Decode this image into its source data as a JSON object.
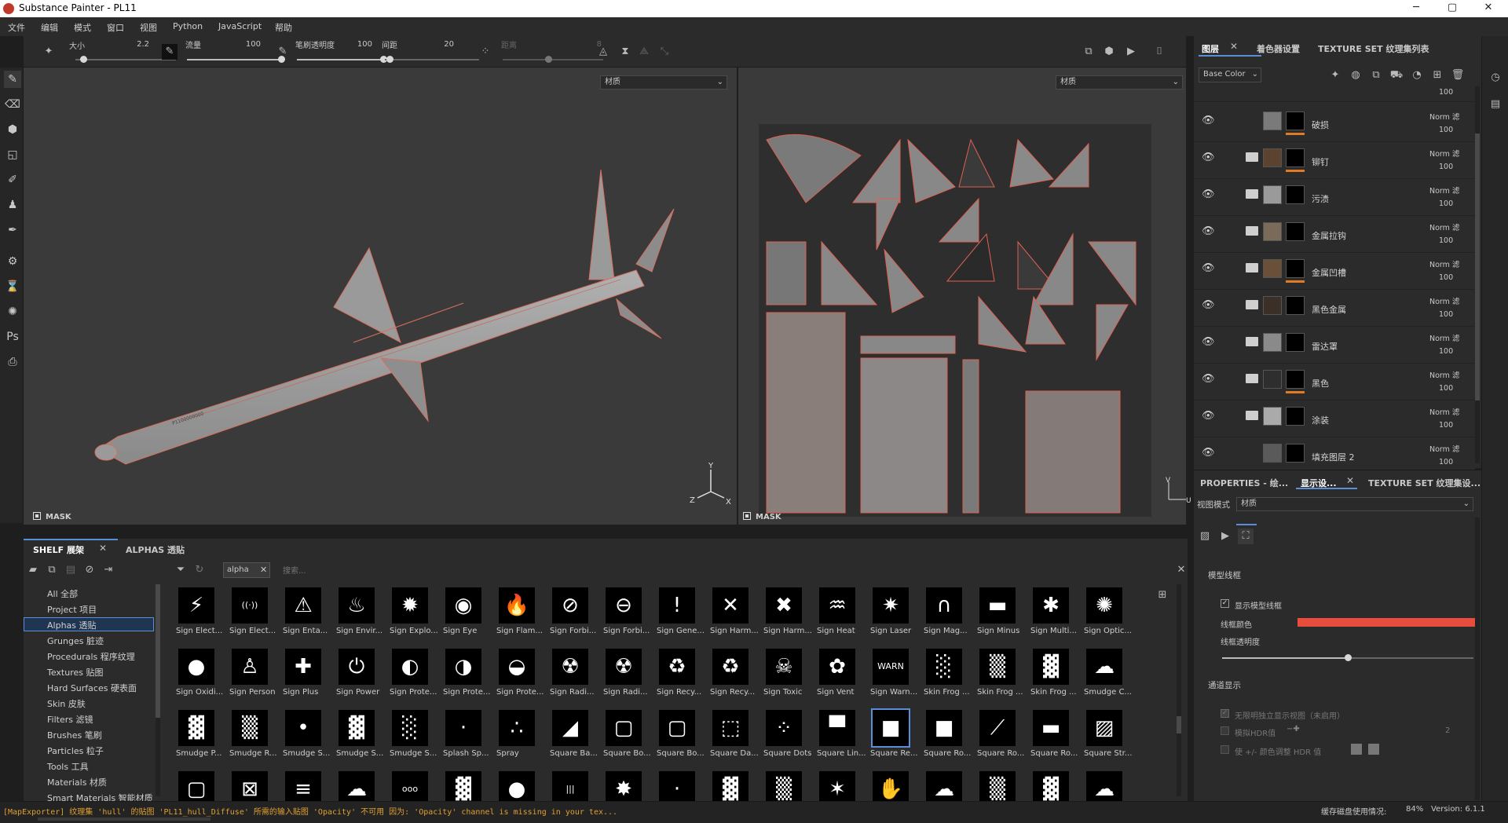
{
  "window": {
    "title": "Substance Painter - PL11",
    "min": "─",
    "max": "▢",
    "close": "✕"
  },
  "menu": [
    "文件",
    "编辑",
    "模式",
    "窗口",
    "视图",
    "Python",
    "JavaScript",
    "帮助"
  ],
  "tool_options": {
    "size_label": "大小",
    "size_value": "2.2",
    "flow_label": "流量",
    "flow_value": "100",
    "stroke_opacity_label": "笔刷透明度",
    "stroke_opacity_value": "100",
    "spacing_label": "间距",
    "spacing_value": "20",
    "distance_label": "距离",
    "distance_value": "8",
    "size_level": 0.08,
    "flow_level": 1.0,
    "opacity_level": 1.0,
    "spacing_level": 0.05,
    "distance_level": 0.45
  },
  "viewport3d": {
    "channel_select": "材质",
    "mask_label": "MASK"
  },
  "viewport2d": {
    "channel_select": "材质",
    "mask_label": "MASK"
  },
  "layers_panel": {
    "tabs": [
      "图层",
      "着色器设置",
      "TEXTURE SET 纹理集列表"
    ],
    "channel_select": "Base Color",
    "top_opacity": "100",
    "layers": [
      {
        "name": "破损",
        "blend": "Norm 滤",
        "opacity": "100",
        "thumb_color": "#7a7a7a",
        "has_folder": false,
        "has_orange": true
      },
      {
        "name": "铆钉",
        "blend": "Norm 滤",
        "opacity": "100",
        "thumb_color": "#5c4330",
        "has_folder": true,
        "has_orange": true
      },
      {
        "name": "污渍",
        "blend": "Norm 滤",
        "opacity": "100",
        "thumb_color": "#9a9a9a",
        "has_folder": true,
        "has_orange": false
      },
      {
        "name": "金属拉钩",
        "blend": "Norm 滤",
        "opacity": "100",
        "thumb_color": "#7a6a5a",
        "has_folder": true,
        "has_orange": false
      },
      {
        "name": "金属凹槽",
        "blend": "Norm 滤",
        "opacity": "100",
        "thumb_color": "#6a5038",
        "has_folder": true,
        "has_orange": true
      },
      {
        "name": "黑色金属",
        "blend": "Norm 滤",
        "opacity": "100",
        "thumb_color": "#3a3028",
        "has_folder": true,
        "has_orange": false
      },
      {
        "name": "雷达罩",
        "blend": "Norm 滤",
        "opacity": "100",
        "thumb_color": "#8a8a8a",
        "has_folder": true,
        "has_orange": false
      },
      {
        "name": "黑色",
        "blend": "Norm 滤",
        "opacity": "100",
        "thumb_color": "#2e2e2e",
        "has_folder": true,
        "has_orange": true
      },
      {
        "name": "涂装",
        "blend": "Norm 滤",
        "opacity": "100",
        "thumb_color": "#aaaaaa",
        "has_folder": true,
        "has_orange": false
      },
      {
        "name": "填充图层 2",
        "blend": "Norm 滤",
        "opacity": "100",
        "thumb_color": "#5a5a5a",
        "has_folder": false,
        "has_orange": false
      }
    ]
  },
  "props_panel": {
    "tabs": [
      "PROPERTIES - 绘...",
      "显示设...",
      "TEXTURE SET 纹理集设..."
    ],
    "view_mode_label": "视图模式",
    "view_mode_value": "材质",
    "section_wireframe": "模型线框",
    "show_wire_label": "显示模型线框",
    "wire_color_label": "线框颜色",
    "wire_color": "#e74c3c",
    "wire_opacity_label": "线框透明度",
    "wire_opacity_level": 0.5,
    "section_channel": "通道显示",
    "channel_opt1": "无限明独立显示视图（未启用）",
    "channel_opt2": "模拟HDR值",
    "channel_opt2_val": "2",
    "channel_opt3": "使 +/- 颜色调整 HDR 值"
  },
  "shelf": {
    "tabs": [
      "SHELF 展架",
      "ALPHAS 透贴"
    ],
    "filter_tag": "alpha",
    "search_placeholder": "搜索...",
    "categories": [
      "All 全部",
      "Project 项目",
      "Alphas 透贴",
      "Grunges 脏迹",
      "Procedurals 程序纹理",
      "Textures 贴图",
      "Hard Surfaces 硬表面",
      "Skin 皮肤",
      "Filters 滤镜",
      "Brushes 笔刷",
      "Particles 粒子",
      "Tools 工具",
      "Materials 材质",
      "Smart Materials 智能材质"
    ],
    "selected_category": 2,
    "alphas": [
      [
        "Sign Elect...",
        "Sign Elect...",
        "Sign Enta...",
        "Sign Envir...",
        "Sign Explo...",
        "Sign Eye",
        "Sign Flam...",
        "Sign Forbi...",
        "Sign Forbi...",
        "Sign Gene...",
        "Sign Harm...",
        "Sign Harm...",
        "Sign Heat",
        "Sign Laser",
        "Sign Mag...",
        "Sign Minus",
        "Sign Multi...",
        "Sign Optic..."
      ],
      [
        "Sign Oxidi...",
        "Sign Person",
        "Sign Plus",
        "Sign Power",
        "Sign Prote...",
        "Sign Prote...",
        "Sign Prote...",
        "Sign Radi...",
        "Sign Radi...",
        "Sign Recy...",
        "Sign Recy...",
        "Sign Toxic",
        "Sign Vent",
        "Sign Warn...",
        "Skin Frog ...",
        "Skin Frog ...",
        "Skin Frog ...",
        "Smudge C..."
      ],
      [
        "Smudge P...",
        "Smudge R...",
        "Smudge S...",
        "Smudge S...",
        "Smudge S...",
        "Splash Sp...",
        "Spray",
        "Square Ba...",
        "Square Bo...",
        "Square Bo...",
        "Square Da...",
        "Square Dots",
        "Square Lin...",
        "Square Re...",
        "Square Ro...",
        "Square Ro...",
        "Square Ro...",
        "Square Str..."
      ],
      [
        "",
        "",
        "",
        "",
        "",
        "",
        "",
        "",
        "",
        "",
        "",
        "",
        "",
        "",
        "",
        "",
        "",
        ""
      ]
    ],
    "glyphs": [
      [
        "⚡",
        "((·))",
        "⚠",
        "♨",
        "✹",
        "◉",
        "🔥",
        "⊘",
        "⊖",
        "!",
        "✕",
        "✖",
        "♒",
        "✷",
        "∩",
        "▬",
        "✱",
        "✺"
      ],
      [
        "●",
        "♙",
        "✚",
        "⏻",
        "◐",
        "◑",
        "◒",
        "☢",
        "☢",
        "♻",
        "♻",
        "☠",
        "✿",
        "WARN",
        "░",
        "▒",
        "▓",
        "☁"
      ],
      [
        "▓",
        "▒",
        "•",
        "▓",
        "░",
        "·",
        "∴",
        "◢",
        "▢",
        "▢",
        "⬚",
        "⁘",
        "▀",
        "■",
        "■",
        "⟋",
        "▬",
        "▨"
      ],
      [
        "▢",
        "⊠",
        "≡",
        "☁",
        "ooo",
        "▓",
        "●",
        "|||",
        "✸",
        "·",
        "▓",
        "▒",
        "✶",
        "✋",
        "☁",
        "▒",
        "▓",
        "☁"
      ]
    ],
    "selected_alpha": "2-13"
  },
  "status": {
    "message": "[MapExporter] 纹理集 'hull' 的贴图 'PL11_hull_Diffuse' 所需的输入贴图 'Opacity' 不可用 因为: 'Opacity' channel is missing in your tex...",
    "disk_label": "缓存磁盘使用情况:",
    "disk_value": "84%",
    "version": "Version: 6.1.1"
  }
}
